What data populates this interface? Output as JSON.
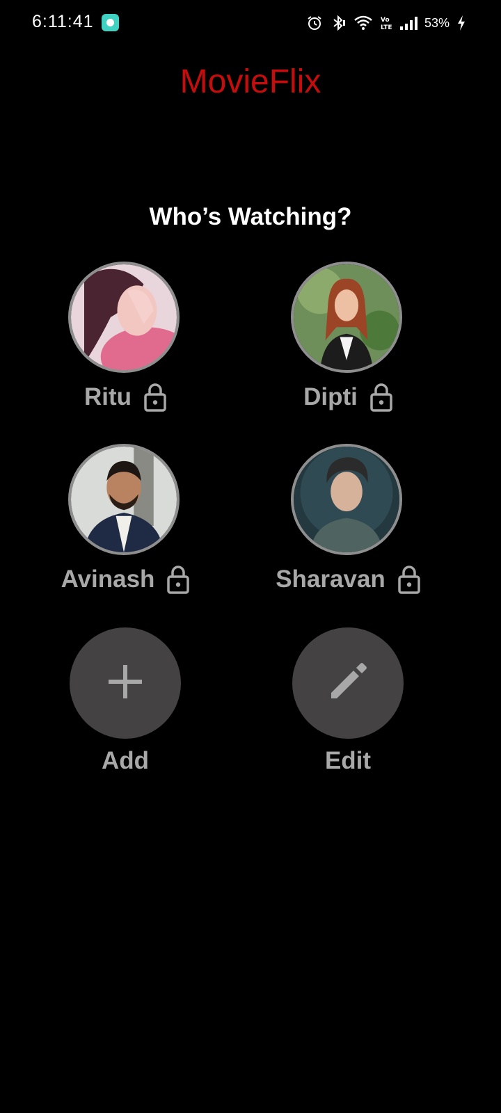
{
  "status_bar": {
    "time": "6:11:41",
    "battery": "53%",
    "icons": [
      "app-notification-icon",
      "alarm-icon",
      "bluetooth-icon",
      "wifi-icon",
      "volte-icon",
      "signal-icon",
      "charging-icon"
    ]
  },
  "app": {
    "title": "MovieFlix",
    "title_color": "#c50d0d"
  },
  "heading": "Who’s Watching?",
  "profiles": [
    {
      "name": "Ritu",
      "locked": true
    },
    {
      "name": "Dipti",
      "locked": true
    },
    {
      "name": "Avinash",
      "locked": true
    },
    {
      "name": "Sharavan",
      "locked": true
    }
  ],
  "actions": {
    "add_label": "Add",
    "edit_label": "Edit"
  },
  "colors": {
    "background": "#000000",
    "label_gray": "#a8a8a8",
    "action_circle": "#444243",
    "avatar_border": "#8e8e8e"
  }
}
